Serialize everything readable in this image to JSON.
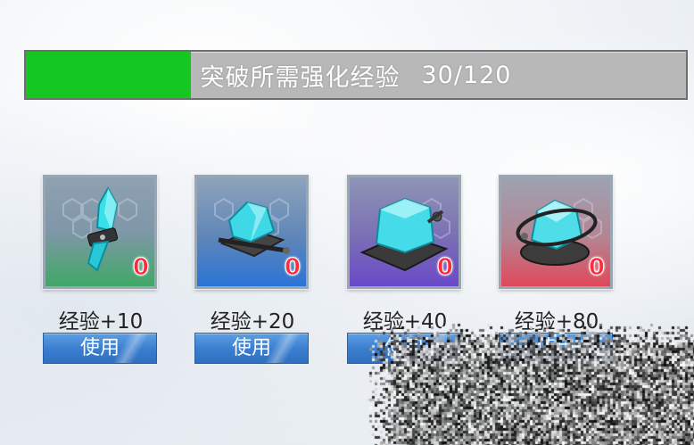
{
  "progress": {
    "label": "突破所需强化经验",
    "value_text": "30/120",
    "current": 30,
    "max": 120,
    "fill_color": "#14c721",
    "track_color": "#b8b8b8"
  },
  "items": [
    {
      "count": "0",
      "exp_label": "经验+10",
      "button_label": "使用",
      "rarity_color": "green"
    },
    {
      "count": "0",
      "exp_label": "经验+20",
      "button_label": "使用",
      "rarity_color": "blue"
    },
    {
      "count": "0",
      "exp_label": "经验+40",
      "button_label": "使用",
      "rarity_color": "purple"
    },
    {
      "count": "0",
      "exp_label": "经验+80",
      "button_label": "使用",
      "rarity_color": "red"
    }
  ]
}
